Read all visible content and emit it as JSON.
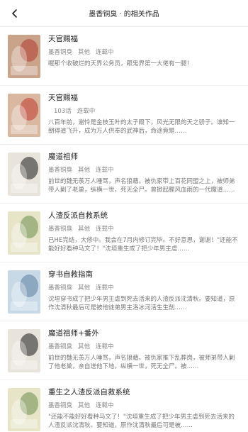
{
  "header": {
    "title": "墨香铜臭 · 的相关作品",
    "back_icon": "back-arrow-icon"
  },
  "books": [
    {
      "title": "天官赐福",
      "author": "墨香铜臭",
      "category": "其他",
      "status": "连载中",
      "description": "喔那个收破烂的天界公务员，跟鬼界第一大佬有一腿！",
      "cover_colors": [
        "#c9a38a",
        "#b23a2e"
      ],
      "cover_text": "天官赐福"
    },
    {
      "title": "天官赐福",
      "author": "",
      "category": "103话",
      "status": "连载中",
      "description": "八百年前，谢怜是金枝玉叶的太子殿下，风光无限的天之骄子。谁知一朝得道飞升，成为万人供奉的武神后，命途竟是……",
      "cover_colors": [
        "#d9b7a0",
        "#c0392b"
      ],
      "cover_text": "天官赐福"
    },
    {
      "title": "魔道祖师",
      "author": "墨香铜臭",
      "category": "其他",
      "status": "连载中",
      "description": "前世的魏无羡万人唾骂，声名狼藉。被仇家带上百花同盟之上，被师弟带人剿了老巢，纵横一世，死无全尸。曾掀起腥风血雨的一代魔道……",
      "cover_colors": [
        "#e8e4dc",
        "#1a1a1a"
      ],
      "cover_text": "魔道祖师"
    },
    {
      "title": "人渣反派自救系统",
      "author": "墨香铜臭",
      "category": "其他",
      "status": "连载中",
      "description": "已HE完结，大修中。我会在7月内修订完毕。不好意思，谢谢！\"还能不能好好看种马文了！\"沈垣重生成了把少年男主虐……",
      "cover_colors": [
        "#e7e4c8",
        "#6b8e4e"
      ],
      "cover_text": "人渣反派自救系统"
    },
    {
      "title": "穿书自救指南",
      "author": "墨香铜臭",
      "category": "其他",
      "status": "连载中",
      "description": "沈垣穿书成了把少年男主虐到死去活来的人渣反派沈清秋。要知道，原作沈清秋最后可是被他徒弟男主洛冰河活生生削……",
      "cover_colors": [
        "#c7d9e6",
        "#5b7fa0"
      ],
      "cover_text": "穿书自救指南"
    },
    {
      "title": "魔道祖师+番外",
      "author": "墨香铜臭",
      "category": "其他",
      "status": "连载中",
      "description": "前世的魏无羡万人唾骂，声名狼藉。被仇家推下乱葬岗，被师弟带人剿了他老巢，亲自送他下地，纵横一世，死无全尸。被……",
      "cover_colors": [
        "#e8e4dc",
        "#1a1a1a"
      ],
      "cover_text": "魔道祖师"
    },
    {
      "title": "重生之人渣反派自救系统",
      "author": "墨香铜臭",
      "category": "其他",
      "status": "连载中",
      "description": "\"还能不能好好看种马文了！\"沈垣重生成了把少年男主虐到死去活来的人渣反派沈清秋。要知道，原作沈清秋最后可是被……",
      "cover_colors": [
        "#e7e4c8",
        "#6b8e4e"
      ],
      "cover_text": "人渣反派自救系统"
    }
  ]
}
